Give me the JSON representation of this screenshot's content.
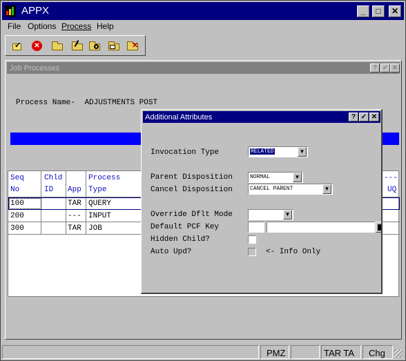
{
  "window": {
    "title": "APPX",
    "minimize_label": "_",
    "maximize_label": "□",
    "close_label": "✕"
  },
  "menu": {
    "items": [
      {
        "label": "File"
      },
      {
        "label": "Options"
      },
      {
        "label": "Process"
      },
      {
        "label": "Help"
      }
    ]
  },
  "toolbar": {
    "icons": [
      "check-edit-icon",
      "cancel-icon",
      "new-folder-icon",
      "edit-folder-icon",
      "find-folder-icon",
      "copy-folder-icon",
      "delete-folder-icon"
    ]
  },
  "child_window": {
    "title": "Job Processes",
    "help_label": "?",
    "ok_label": "✓",
    "close_label": "✕"
  },
  "process": {
    "label": "Process Name-",
    "value": "ADJUSTMENTS POST"
  },
  "grid": {
    "headers_top": [
      "Seq",
      "Chld",
      "",
      "Process"
    ],
    "headers_bottom": [
      "No",
      "ID",
      "App",
      "Type"
    ],
    "right_header_top": "---",
    "right_header_bottom": "UQ",
    "rows": [
      {
        "seq": "100",
        "chld": "",
        "app": "TAR",
        "type": "QUERY"
      },
      {
        "seq": "200",
        "chld": "",
        "app": "---",
        "type": "INPUT"
      },
      {
        "seq": "300",
        "chld": "",
        "app": "TAR",
        "type": "JOB"
      }
    ]
  },
  "dialog": {
    "title": "Additional Attributes",
    "help_label": "?",
    "ok_label": "✓",
    "close_label": "✕",
    "invocation_type": {
      "label": "Invocation Type",
      "value": "RELATED"
    },
    "parent_disposition": {
      "label": "Parent Disposition",
      "value": "NORMAL"
    },
    "cancel_disposition": {
      "label": "Cancel Disposition",
      "value": "CANCEL PARENT"
    },
    "override_dflt_mode": {
      "label": "Override Dflt Mode",
      "value": ""
    },
    "default_pcf_key": {
      "label": "Default PCF Key",
      "value1": "",
      "value2": ""
    },
    "hidden_child": {
      "label": "Hidden Child?",
      "checked": false
    },
    "auto_upd": {
      "label": "Auto Upd?",
      "checked": false,
      "note": "<- Info Only"
    }
  },
  "status": {
    "panels": [
      "",
      "PMZ",
      "",
      "TAR TA",
      "Chg"
    ]
  },
  "colors": {
    "title_active": "#000080",
    "title_inactive": "#808080",
    "highlight_bar": "#0000ff",
    "header_text": "#1010c0",
    "face": "#c0c0c0"
  }
}
